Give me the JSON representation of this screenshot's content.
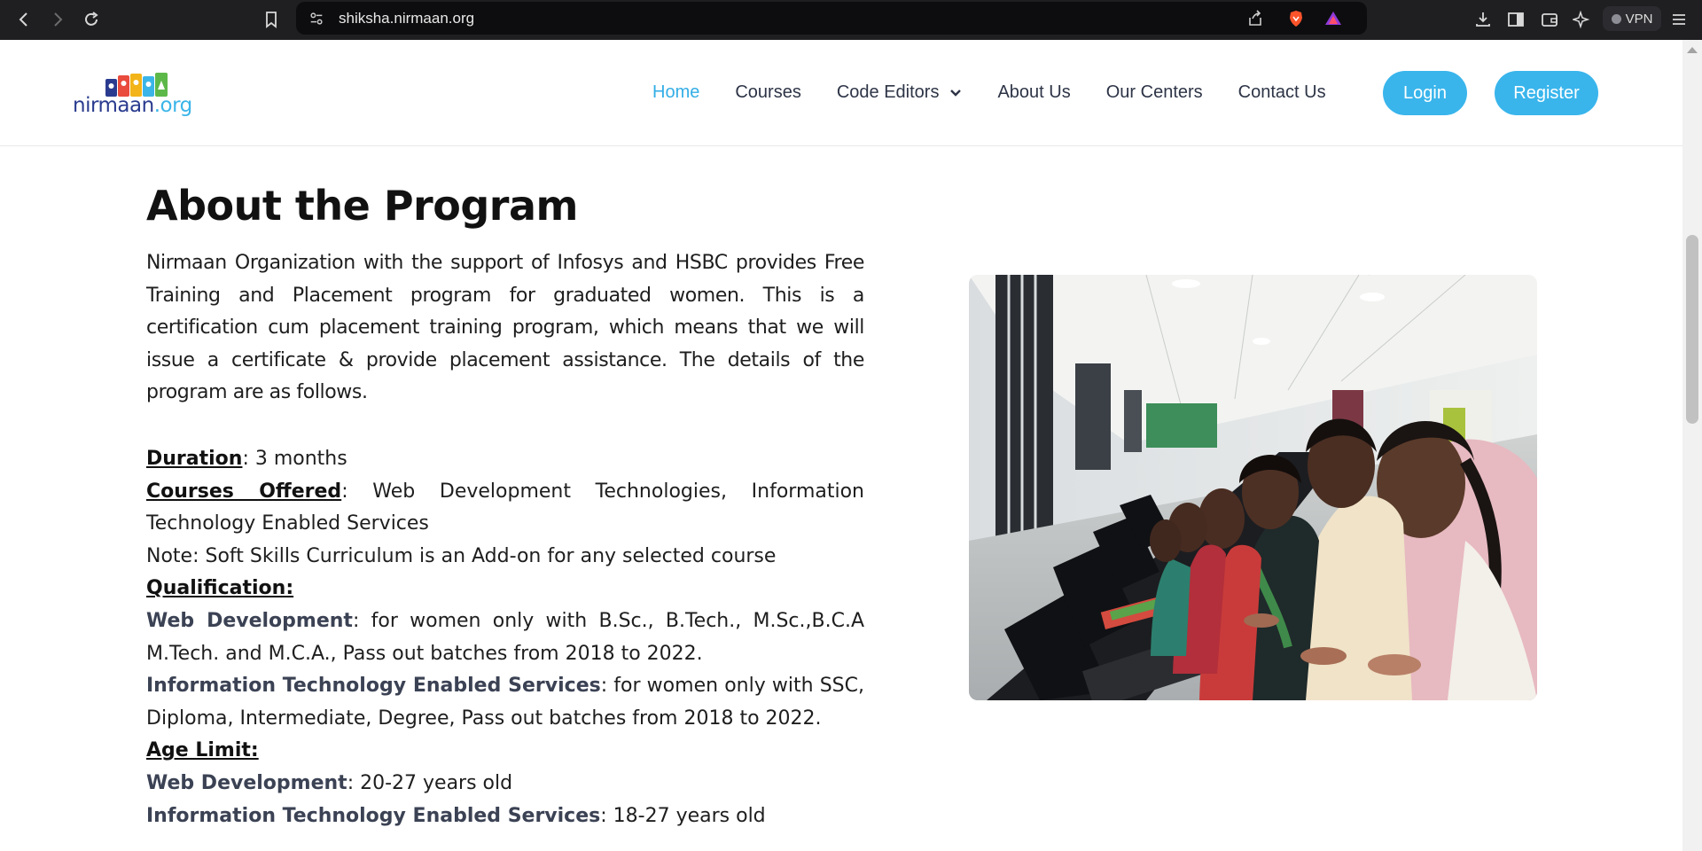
{
  "browser": {
    "url": "shiksha.nirmaan.org",
    "vpn_label": "VPN"
  },
  "site": {
    "logo": {
      "name": "nirmaan",
      "suffix": ".org"
    },
    "nav": [
      {
        "label": "Home",
        "active": true
      },
      {
        "label": "Courses"
      },
      {
        "label": "Code Editors",
        "dropdown": true
      },
      {
        "label": "About Us"
      },
      {
        "label": "Our Centers"
      },
      {
        "label": "Contact Us"
      }
    ],
    "login_label": "Login",
    "register_label": "Register",
    "accent_color": "#39b5ec"
  },
  "program": {
    "title": "About the Program",
    "intro": "Nirmaan Organization with the support of Infosys and HSBC provides Free Training and Placement program for graduated women. This is a certification cum placement training program, which means that we will issue a certificate & provide placement assistance. The details of the program are as follows.",
    "duration_label": "Duration",
    "duration_value": ": 3 months",
    "courses_label": "Courses Offered",
    "courses_value": ": Web Development Technologies, Information Technology Enabled Services",
    "note": "Note: Soft Skills Curriculum is an Add-on for any selected course",
    "qualification_label": "Qualification:",
    "qual_web_label": "Web Development",
    "qual_web_value": ": for women only with B.Sc., B.Tech., M.Sc.,B.C.A M.Tech. and M.C.A., Pass out batches from 2018 to 2022.",
    "qual_ites_label": "Information Technology Enabled Services",
    "qual_ites_value": ": for women only with SSC, Diploma, Intermediate, Degree, Pass out batches from 2018 to 2022.",
    "age_label": "Age Limit:",
    "age_web_label": "Web Development",
    "age_web_value": ": 20-27 years old",
    "age_ites_label": "Information Technology Enabled Services",
    "age_ites_value": ": 18-27 years old"
  }
}
